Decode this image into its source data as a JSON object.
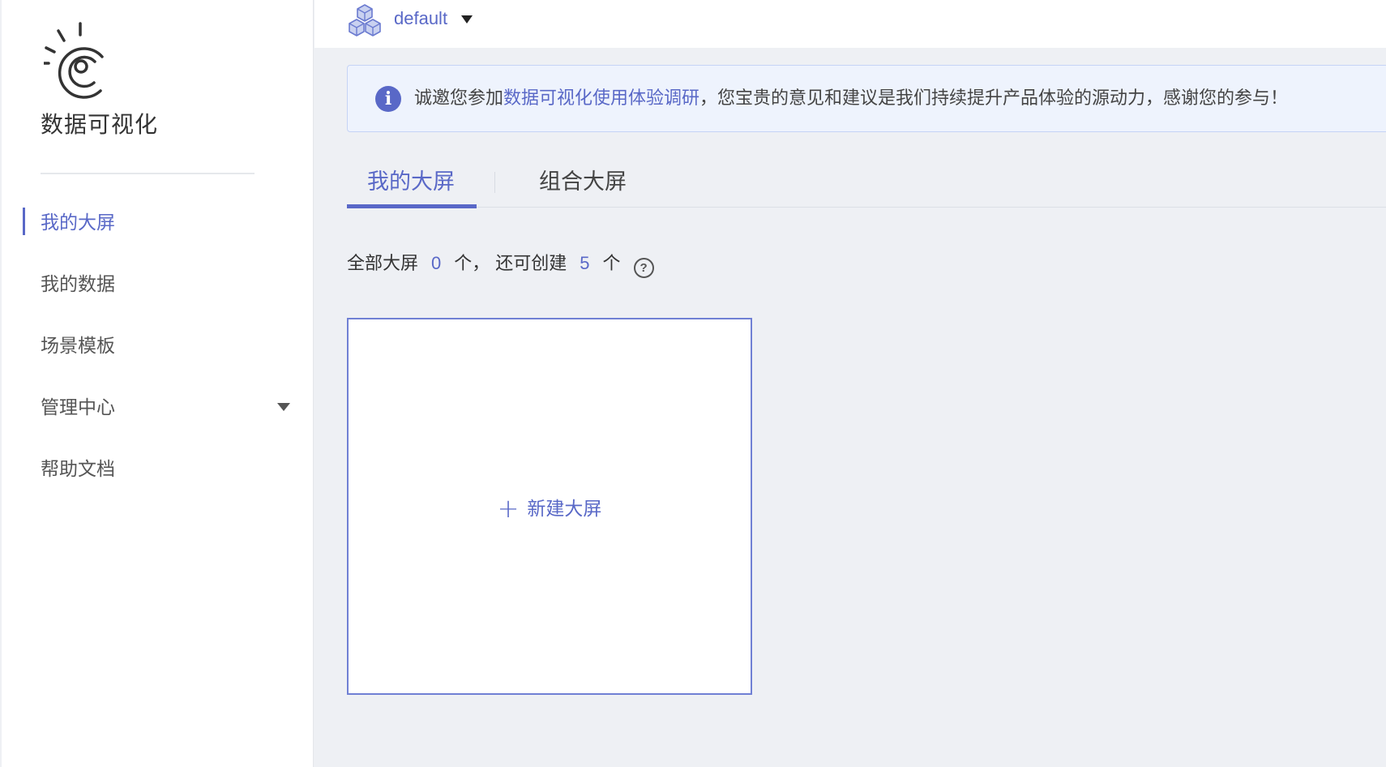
{
  "brand": {
    "title": "数据可视化",
    "logo_icon": "eye-sun-logo-icon"
  },
  "sidebar": {
    "items": [
      {
        "label": "我的大屏",
        "active": true
      },
      {
        "label": "我的数据",
        "active": false
      },
      {
        "label": "场景模板",
        "active": false
      },
      {
        "label": "管理中心",
        "active": false,
        "has_caret": true
      },
      {
        "label": "帮助文档",
        "active": false
      }
    ]
  },
  "workspace": {
    "name": "default",
    "icon": "cubes-icon"
  },
  "notice": {
    "prefix": "诚邀您参加",
    "link": "数据可视化使用体验调研",
    "suffix": "，您宝贵的意见和建议是我们持续提升产品体验的源动力，感谢您的参与！"
  },
  "tabs": [
    {
      "label": "我的大屏",
      "active": true
    },
    {
      "label": "组合大屏",
      "active": false
    }
  ],
  "counts": {
    "prefix": "全部大屏",
    "total": "0",
    "mid": "个，  还可创建",
    "remaining": "5",
    "suffix": "个",
    "help_glyph": "?"
  },
  "create_card": {
    "plus": "+",
    "label": "新建大屏"
  },
  "colors": {
    "accent": "#5968c7",
    "background": "#eef0f4",
    "notice_bg": "#eef3fd"
  }
}
